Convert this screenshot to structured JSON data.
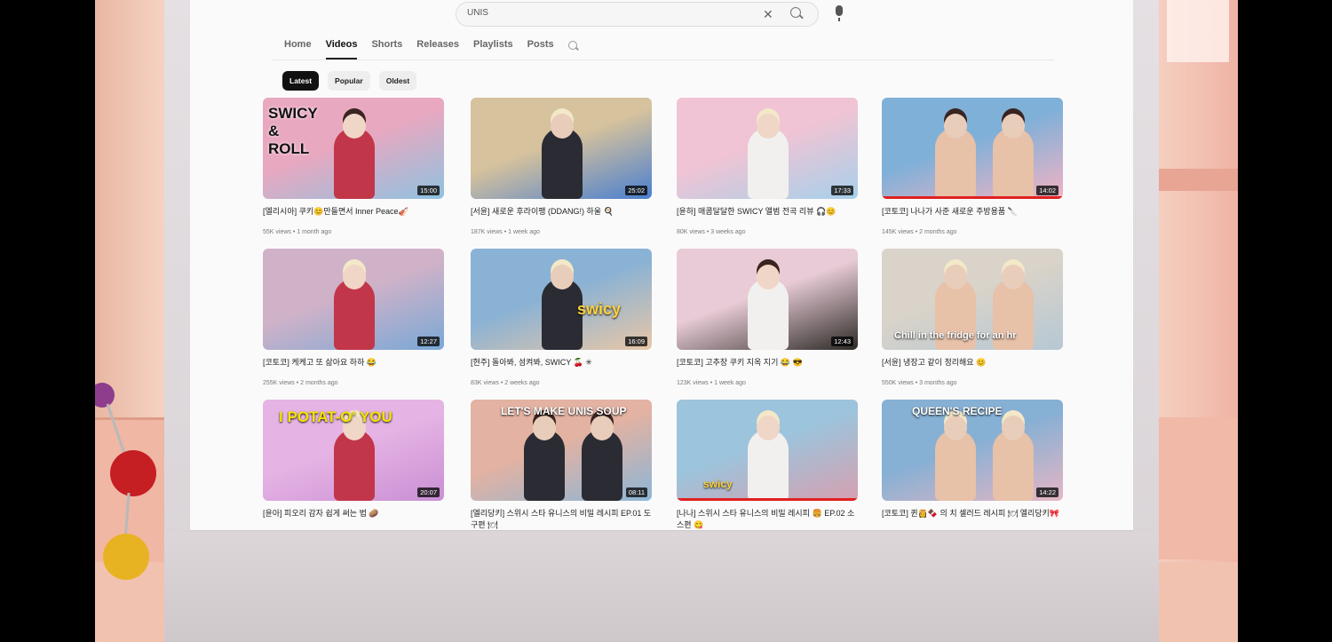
{
  "search": {
    "query": "UNIS"
  },
  "tabs": [
    "Home",
    "Videos",
    "Shorts",
    "Releases",
    "Playlists",
    "Posts"
  ],
  "active_tab": "Videos",
  "filters": [
    "Latest",
    "Popular",
    "Oldest"
  ],
  "active_filter": "Latest",
  "videos": [
    {
      "title": "[엘리시아] 쿠키😊만들면서 Inner Peace🎻",
      "meta": "55K views • 1 month ago",
      "duration": "15:00",
      "overlay": "SWICY & ROLL",
      "colors": [
        "#e8a8c0",
        "#8fc2e0"
      ]
    },
    {
      "title": "[서윤] 새로운 후라이팽 (DDANG!) 하울 🍳",
      "meta": "187K views • 1 week ago",
      "duration": "25:02",
      "overlay": "",
      "colors": [
        "#d6c29c",
        "#4a7fd0"
      ]
    },
    {
      "title": "[윤하] 매콤달달한 SWICY 앨범 전곡 리뷰 🎧😊",
      "meta": "80K views • 3 weeks ago",
      "duration": "17:33",
      "overlay": "",
      "colors": [
        "#f0c4d4",
        "#a7d0ea"
      ]
    },
    {
      "title": "[코토코] 나나가 사준 새로운 주방용품 🔪",
      "meta": "145K views • 2 months ago",
      "duration": "14:02",
      "overlay": "",
      "colors": [
        "#7fb0d8",
        "#f3b3c4"
      ]
    },
    {
      "title": "[코토코] 케케고 또 삶아요 하하 😂",
      "meta": "255K views • 2 months ago",
      "duration": "12:27",
      "overlay": "",
      "colors": [
        "#d0b2c8",
        "#7aa8d6"
      ]
    },
    {
      "title": "[현주] 돌아봐, 섬켜봐, SWICY 🍒 ✳",
      "meta": "83K views • 2 weeks ago",
      "duration": "16:09",
      "overlay": "swicy",
      "colors": [
        "#8ab2d4",
        "#e8c7a8"
      ]
    },
    {
      "title": "[코토코] 고추장 쿠키 지옥 지기 😂 😎",
      "meta": "123K views • 1 week ago",
      "duration": "12:43",
      "overlay": "",
      "colors": [
        "#e8cbd6",
        "#2c2a26"
      ]
    },
    {
      "title": "[서윤] 냉장고 같이 정리해요 😊",
      "meta": "550K views • 3 months ago",
      "duration": "",
      "overlay": "Chill in the fridge for an hr",
      "colors": [
        "#d9d3c9",
        "#b6c8d4"
      ]
    },
    {
      "title": "[윤아] 피오리 감자 쉽게 써는 법 🥔",
      "meta": "",
      "duration": "20:07",
      "overlay": "I  POTAT-O' YOU",
      "colors": [
        "#e6b4e4",
        "#c98fd4"
      ]
    },
    {
      "title": "[엘리당키] 스위시 스타 유니스의 비밀 레시피 EP.01 도구편 🍽",
      "meta": "",
      "duration": "08:11",
      "overlay": "LET'S MAKE UNIS SOUP",
      "colors": [
        "#e3b2a2",
        "#8cb6d6"
      ]
    },
    {
      "title": "[나나] 스위시 스타 유니스의 비밀 레시피 🍔 EP.02 소스편 😋",
      "meta": "",
      "duration": "",
      "overlay": "swicy",
      "colors": [
        "#9cc4dc",
        "#d6a0b0"
      ]
    },
    {
      "title": "[코토코] 퀸👸🍫 의 치 셀러드 레시피 🍽 엘리당키🎀",
      "meta": "",
      "duration": "14:22",
      "overlay": "QUEEN'S RECIPE",
      "colors": [
        "#86b0d4",
        "#e6b6c4"
      ]
    }
  ]
}
